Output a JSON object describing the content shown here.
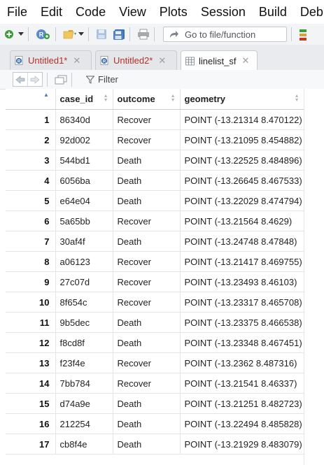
{
  "menu": [
    "File",
    "Edit",
    "Code",
    "View",
    "Plots",
    "Session",
    "Build",
    "Deb"
  ],
  "toolbar": {
    "goto_placeholder": "Go to file/function"
  },
  "tabs": [
    {
      "label": "Untitled1*",
      "type": "script",
      "color": "#b5312c"
    },
    {
      "label": "Untitled2*",
      "type": "script",
      "color": "#b5312c"
    },
    {
      "label": "linelist_sf",
      "type": "data",
      "color": "#222222"
    }
  ],
  "viewer": {
    "filter_label": "Filter"
  },
  "table": {
    "columns": [
      "case_id",
      "outcome",
      "geometry"
    ],
    "rows": [
      {
        "idx": "1",
        "case_id": "86340d",
        "outcome": "Recover",
        "geometry": "POINT (-13.21314 8.470122)"
      },
      {
        "idx": "2",
        "case_id": "92d002",
        "outcome": "Recover",
        "geometry": "POINT (-13.21095 8.454882)"
      },
      {
        "idx": "3",
        "case_id": "544bd1",
        "outcome": "Death",
        "geometry": "POINT (-13.22525 8.484896)"
      },
      {
        "idx": "4",
        "case_id": "6056ba",
        "outcome": "Death",
        "geometry": "POINT (-13.26645 8.467533)"
      },
      {
        "idx": "5",
        "case_id": "e64e04",
        "outcome": "Death",
        "geometry": "POINT (-13.22029 8.474794)"
      },
      {
        "idx": "6",
        "case_id": "5a65bb",
        "outcome": "Recover",
        "geometry": "POINT (-13.21564 8.4629)"
      },
      {
        "idx": "7",
        "case_id": "30af4f",
        "outcome": "Death",
        "geometry": "POINT (-13.24748 8.47848)"
      },
      {
        "idx": "8",
        "case_id": "a06123",
        "outcome": "Recover",
        "geometry": "POINT (-13.21417 8.469755)"
      },
      {
        "idx": "9",
        "case_id": "27c07d",
        "outcome": "Recover",
        "geometry": "POINT (-13.23493 8.46103)"
      },
      {
        "idx": "10",
        "case_id": "8f654c",
        "outcome": "Recover",
        "geometry": "POINT (-13.23317 8.465708)"
      },
      {
        "idx": "11",
        "case_id": "9b5dec",
        "outcome": "Death",
        "geometry": "POINT (-13.23375 8.466538)"
      },
      {
        "idx": "12",
        "case_id": "f8cd8f",
        "outcome": "Death",
        "geometry": "POINT (-13.23348 8.467451)"
      },
      {
        "idx": "13",
        "case_id": "f23f4e",
        "outcome": "Recover",
        "geometry": "POINT (-13.2362 8.487316)"
      },
      {
        "idx": "14",
        "case_id": "7bb784",
        "outcome": "Recover",
        "geometry": "POINT (-13.21541 8.46337)"
      },
      {
        "idx": "15",
        "case_id": "d74a9e",
        "outcome": "Death",
        "geometry": "POINT (-13.21251 8.482723)"
      },
      {
        "idx": "16",
        "case_id": "212254",
        "outcome": "Death",
        "geometry": "POINT (-13.22494 8.485828)"
      },
      {
        "idx": "17",
        "case_id": "cb8f4e",
        "outcome": "Death",
        "geometry": "POINT (-13.21929 8.483079)"
      }
    ]
  }
}
